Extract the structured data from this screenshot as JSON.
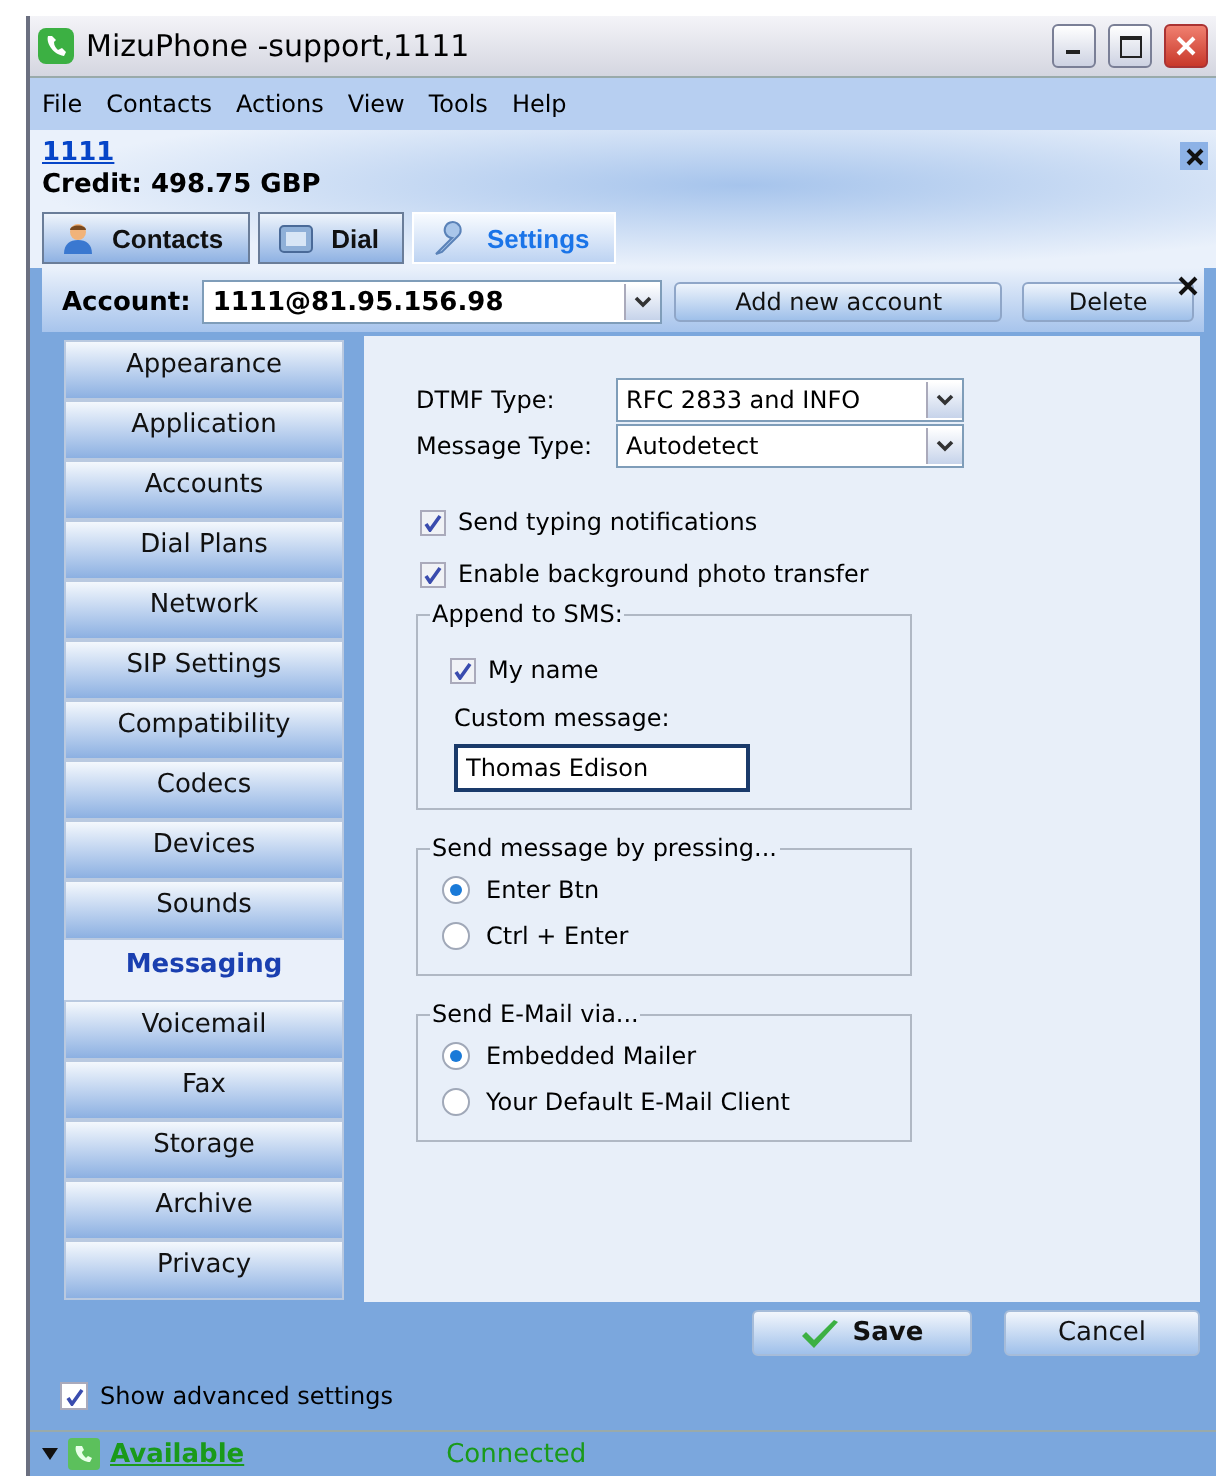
{
  "window": {
    "title": "MizuPhone -support,1111"
  },
  "menu": [
    "File",
    "Contacts",
    "Actions",
    "View",
    "Tools",
    "Help"
  ],
  "header": {
    "user": "1111",
    "credit": "Credit: 498.75 GBP"
  },
  "tabs": [
    {
      "label": "Contacts",
      "kind": "contacts",
      "selected": false
    },
    {
      "label": "Dial",
      "kind": "dial",
      "selected": false
    },
    {
      "label": "Settings",
      "kind": "settings",
      "selected": true
    }
  ],
  "account": {
    "label": "Account:",
    "value": "1111@81.95.156.98",
    "add_button": "Add new account",
    "delete_button": "Delete"
  },
  "sidebar": {
    "items": [
      {
        "label": "Appearance",
        "selected": false
      },
      {
        "label": "Application",
        "selected": false
      },
      {
        "label": "Accounts",
        "selected": false
      },
      {
        "label": "Dial Plans",
        "selected": false
      },
      {
        "label": "Network",
        "selected": false
      },
      {
        "label": "SIP Settings",
        "selected": false
      },
      {
        "label": "Compatibility",
        "selected": false
      },
      {
        "label": "Codecs",
        "selected": false
      },
      {
        "label": "Devices",
        "selected": false
      },
      {
        "label": "Sounds",
        "selected": false
      },
      {
        "label": "Messaging",
        "selected": true
      },
      {
        "label": "Voicemail",
        "selected": false
      },
      {
        "label": "Fax",
        "selected": false
      },
      {
        "label": "Storage",
        "selected": false
      },
      {
        "label": "Archive",
        "selected": false
      },
      {
        "label": "Privacy",
        "selected": false
      }
    ]
  },
  "settings": {
    "dropdowns": [
      {
        "label": "DTMF Type:",
        "value": "RFC 2833 and INFO"
      },
      {
        "label": "Message Type:",
        "value": "Autodetect"
      }
    ],
    "checkboxes": [
      {
        "label": "Send typing notifications",
        "checked": true
      },
      {
        "label": "Enable background photo transfer",
        "checked": true
      }
    ],
    "append_group": {
      "title": "Append to SMS:",
      "my_name": {
        "label": "My name",
        "checked": true
      },
      "custom_label": "Custom message:",
      "custom_value": "Thomas Edison"
    },
    "radio_groups": [
      {
        "title": "Send message by pressing...",
        "options": [
          {
            "label": "Enter Btn",
            "selected": true
          },
          {
            "label": "Ctrl + Enter",
            "selected": false
          }
        ]
      },
      {
        "title": "Send E-Mail via...",
        "options": [
          {
            "label": "Embedded Mailer",
            "selected": true
          },
          {
            "label": "Your Default E-Mail Client",
            "selected": false
          }
        ]
      }
    ]
  },
  "footer_buttons": [
    {
      "label": "Save",
      "kind": "save"
    },
    {
      "label": "Cancel",
      "kind": "cancel"
    }
  ],
  "show_advanced": {
    "label": "Show advanced settings",
    "checked": true
  },
  "status_bar": {
    "presence": "Available",
    "connection": "Connected"
  }
}
